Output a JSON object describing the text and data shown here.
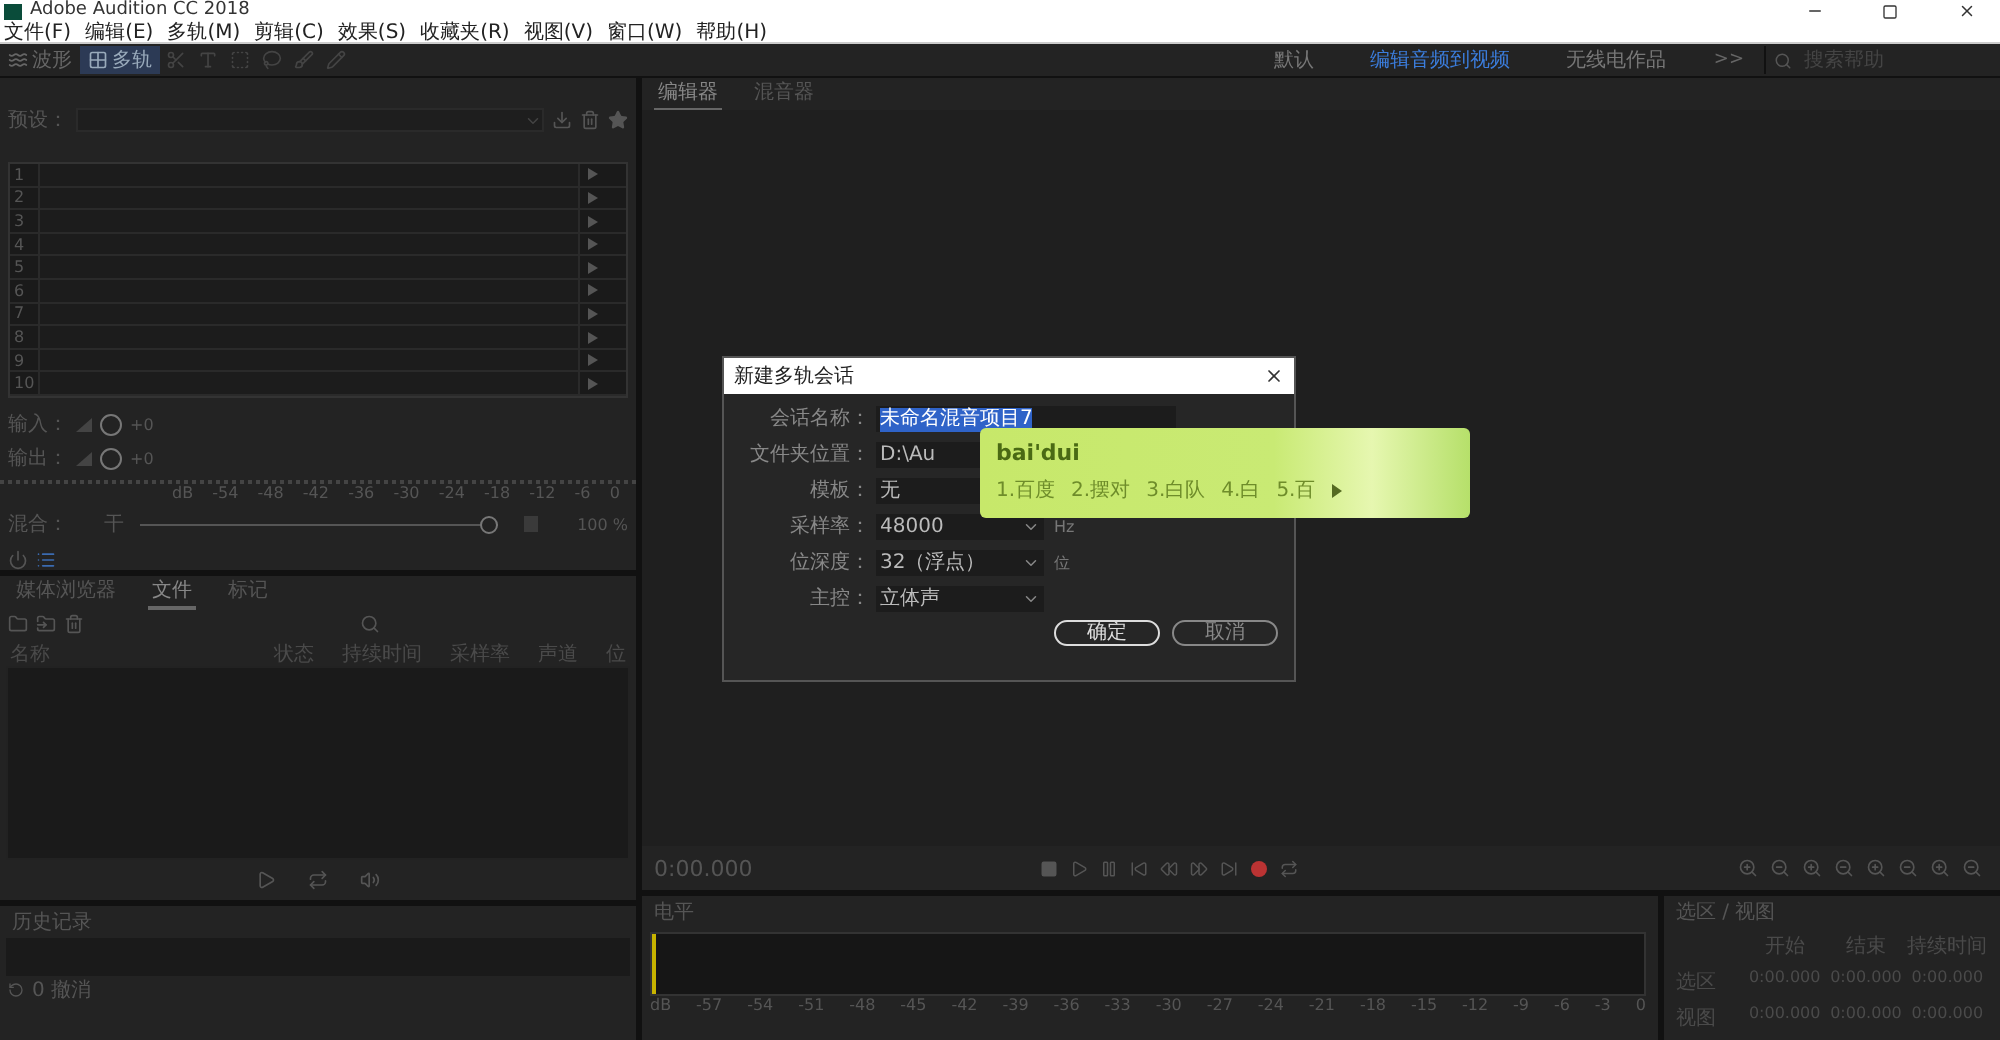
{
  "window": {
    "title": "Adobe Audition CC 2018"
  },
  "menu": [
    "文件(F)",
    "编辑(E)",
    "多轨(M)",
    "剪辑(C)",
    "效果(S)",
    "收藏夹(R)",
    "视图(V)",
    "窗口(W)",
    "帮助(H)"
  ],
  "toolbar": {
    "modes": [
      {
        "label": "波形",
        "selected": false
      },
      {
        "label": "多轨",
        "selected": true
      }
    ]
  },
  "workspaces": [
    {
      "label": "默认",
      "selected": false
    },
    {
      "label": "编辑音频到视频",
      "selected": true
    },
    {
      "label": "无线电作品",
      "selected": false
    }
  ],
  "workspace_more": ">>",
  "search": {
    "placeholder": "搜索帮助"
  },
  "effects_rack": {
    "preset_label": "预设：",
    "slots": [
      "1",
      "2",
      "3",
      "4",
      "5",
      "6",
      "7",
      "8",
      "9",
      "10"
    ],
    "input_label": "输入：",
    "input_value": "+0",
    "output_label": "输出：",
    "output_value": "+0",
    "scale": [
      "dB",
      "-54",
      "-48",
      "-42",
      "-36",
      "-30",
      "-24",
      "-18",
      "-12",
      "-6",
      "0"
    ],
    "mix_label": "混合：",
    "mix_dry": "干",
    "level": 1,
    "mix_reading": "100 %"
  },
  "files_panel": {
    "tabs": [
      {
        "label": "媒体浏览器",
        "selected": false
      },
      {
        "label": "文件",
        "selected": true
      },
      {
        "label": "标记",
        "selected": false
      }
    ],
    "columns": [
      "名称",
      "状态",
      "持续时间",
      "采样率",
      "声道",
      "位"
    ]
  },
  "history": {
    "title": "历史记录",
    "undo": "0 撤消"
  },
  "editor": {
    "tabs": [
      {
        "label": "编辑器",
        "selected": true
      },
      {
        "label": "混音器",
        "selected": false
      }
    ],
    "time": "0:00.000"
  },
  "level_meter": {
    "title": "电平",
    "scale": [
      "dB",
      "-57",
      "-54",
      "-51",
      "-48",
      "-45",
      "-42",
      "-39",
      "-36",
      "-33",
      "-30",
      "-27",
      "-24",
      "-21",
      "-18",
      "-15",
      "-12",
      "-9",
      "-6",
      "-3",
      "0"
    ]
  },
  "selection_view": {
    "title": "选区 / 视图",
    "columns": [
      "开始",
      "结束",
      "持续时间"
    ],
    "rows": [
      {
        "label": "选区",
        "values": [
          "0:00.000",
          "0:00.000",
          "0:00.000"
        ]
      },
      {
        "label": "视图",
        "values": [
          "0:00.000",
          "0:00.000",
          "0:00.000"
        ]
      }
    ]
  },
  "dialog": {
    "title": "新建多轨会话",
    "fields": [
      {
        "kind": "text",
        "label": "会话名称：",
        "value": "未命名混音项目7",
        "selected": true
      },
      {
        "kind": "text",
        "label": "文件夹位置：",
        "value": "D:\\Au",
        "selected": false
      },
      {
        "kind": "select",
        "label": "模板：",
        "value": "无",
        "selected": false
      },
      {
        "kind": "select",
        "label": "采样率：",
        "value": "48000",
        "unit": "Hz",
        "selected": false,
        "arrow": true
      },
      {
        "kind": "select",
        "label": "位深度：",
        "value": "32（浮点）",
        "unit": "位",
        "selected": false,
        "arrow": true
      },
      {
        "kind": "select",
        "label": "主控：",
        "value": "立体声",
        "selected": false,
        "arrow": true
      }
    ],
    "buttons": [
      {
        "label": "确定",
        "selected": true
      },
      {
        "label": "取消",
        "selected": false
      }
    ]
  },
  "ime": {
    "composition": "bai'dui",
    "candidates": [
      "1.百度",
      "2.摆对",
      "3.白队",
      "4.白",
      "5.百"
    ]
  }
}
